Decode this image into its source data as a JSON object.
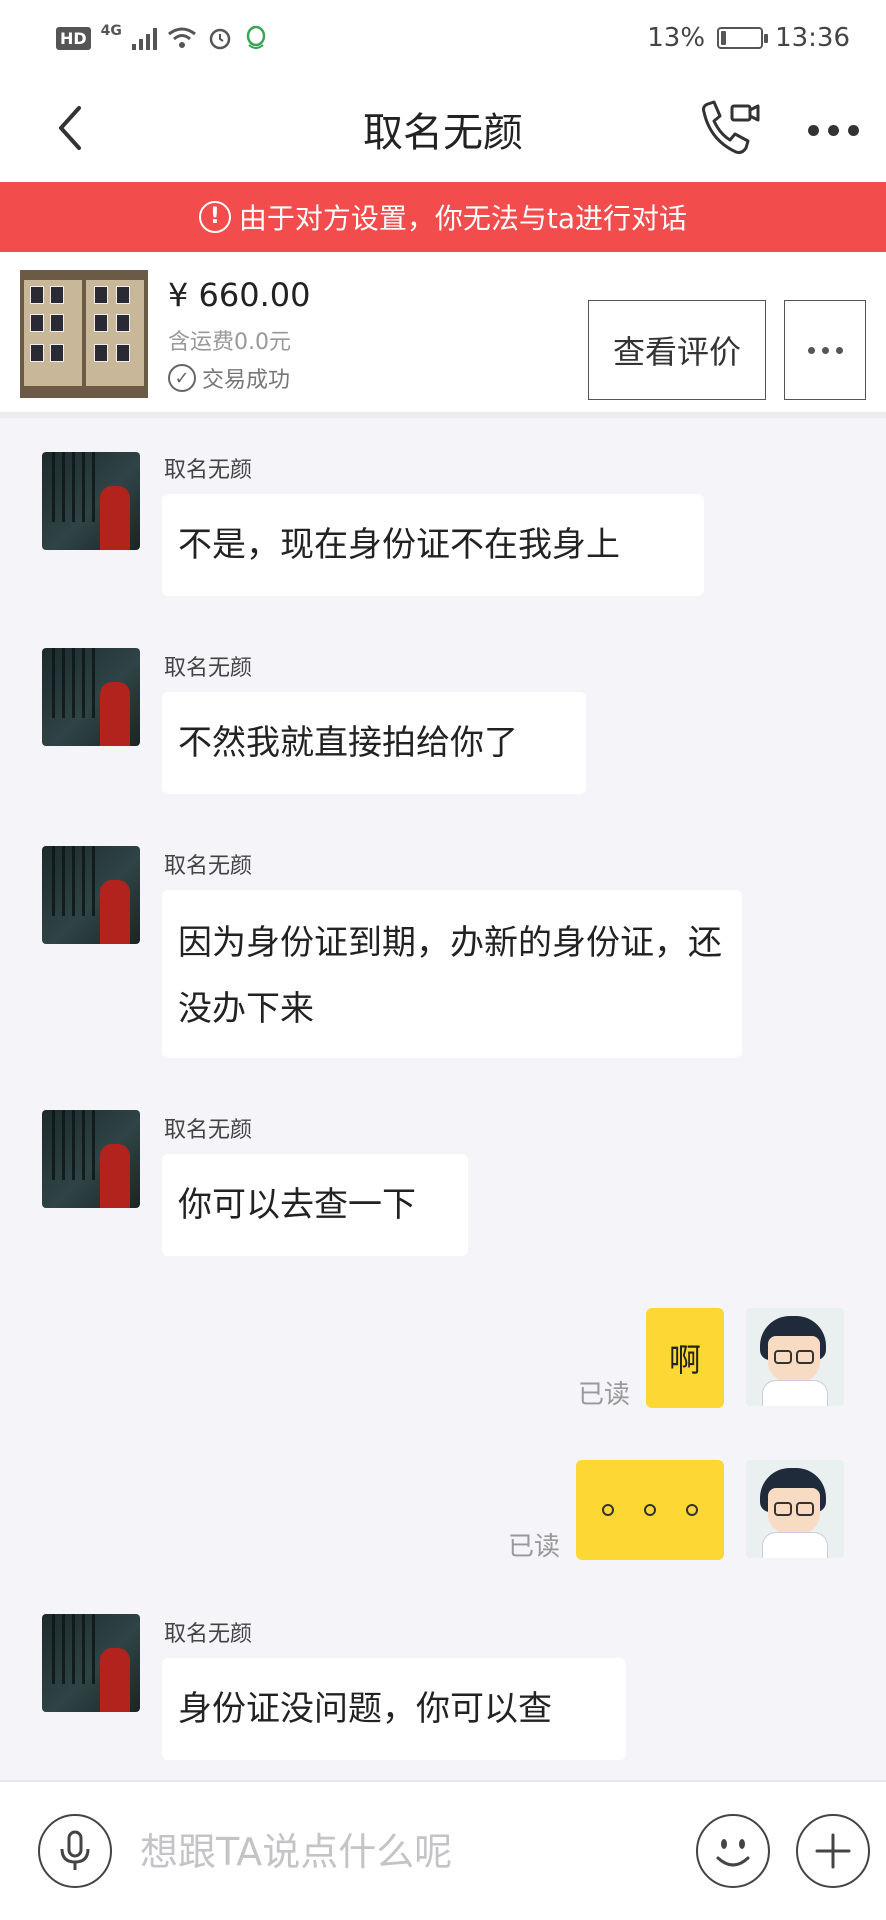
{
  "status_bar": {
    "hd": "HD",
    "network": "4G",
    "battery_text": "13%",
    "battery_level": 0.13,
    "time": "13:36"
  },
  "header": {
    "title": "取名无颜"
  },
  "banner": {
    "text": "由于对方设置，你无法与ta进行对话"
  },
  "product": {
    "price": "¥ 660.00",
    "shipping": "含运费0.0元",
    "status": "交易成功",
    "review_button": "查看评价"
  },
  "messages": [
    {
      "side": "left",
      "sender": "取名无颜",
      "text": "不是，现在身份证不在我身上"
    },
    {
      "side": "left",
      "sender": "取名无颜",
      "text": "不然我就直接拍给你了"
    },
    {
      "side": "left",
      "sender": "取名无颜",
      "text": "因为身份证到期，办新的身份证，还没办下来"
    },
    {
      "side": "left",
      "sender": "取名无颜",
      "text": "你可以去查一下"
    },
    {
      "side": "right",
      "text": "啊",
      "read": "已读"
    },
    {
      "side": "right",
      "text": "。。。",
      "read": "已读"
    },
    {
      "side": "left",
      "sender": "取名无颜",
      "text": "身份证没问题，你可以查"
    }
  ],
  "input": {
    "placeholder": "想跟TA说点什么呢"
  },
  "colors": {
    "banner_bg": "#f24c4c",
    "my_bubble": "#fdd835",
    "background": "#f4f4f9"
  },
  "icons": [
    "back-arrow-icon",
    "video-call-icon",
    "more-icon",
    "warning-icon",
    "check-circle-icon",
    "microphone-icon",
    "emoji-icon",
    "plus-icon"
  ]
}
